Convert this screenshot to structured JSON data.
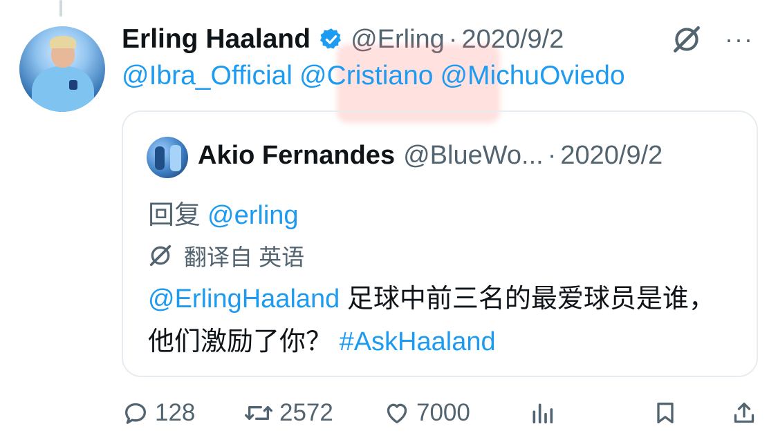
{
  "tweet": {
    "author_name": "Erling Haaland",
    "handle": "@Erling",
    "separator": "·",
    "date": "2020/9/2",
    "mentions": [
      "@Ibra_Official",
      "@Cristiano",
      "@MichuOviedo"
    ],
    "more_label": "···"
  },
  "quote": {
    "author_name": "Akio Fernandes",
    "handle": "@BlueWo...",
    "separator": "·",
    "date": "2020/9/2",
    "reply_prefix": "回复",
    "reply_mention": "@erling",
    "translated_label": "翻译自 英语",
    "body_mention": "@ErlingHaaland",
    "body_text": " 足球中前三名的最爱球员是谁，他们激励了你？",
    "hashtag": "#AskHaaland"
  },
  "actions": {
    "reply_count": "128",
    "retweet_count": "2572",
    "like_count": "7000"
  },
  "colors": {
    "link": "#1d9bf0",
    "muted": "#536471",
    "text": "#0f1419",
    "verified": "#1d9bf0"
  }
}
